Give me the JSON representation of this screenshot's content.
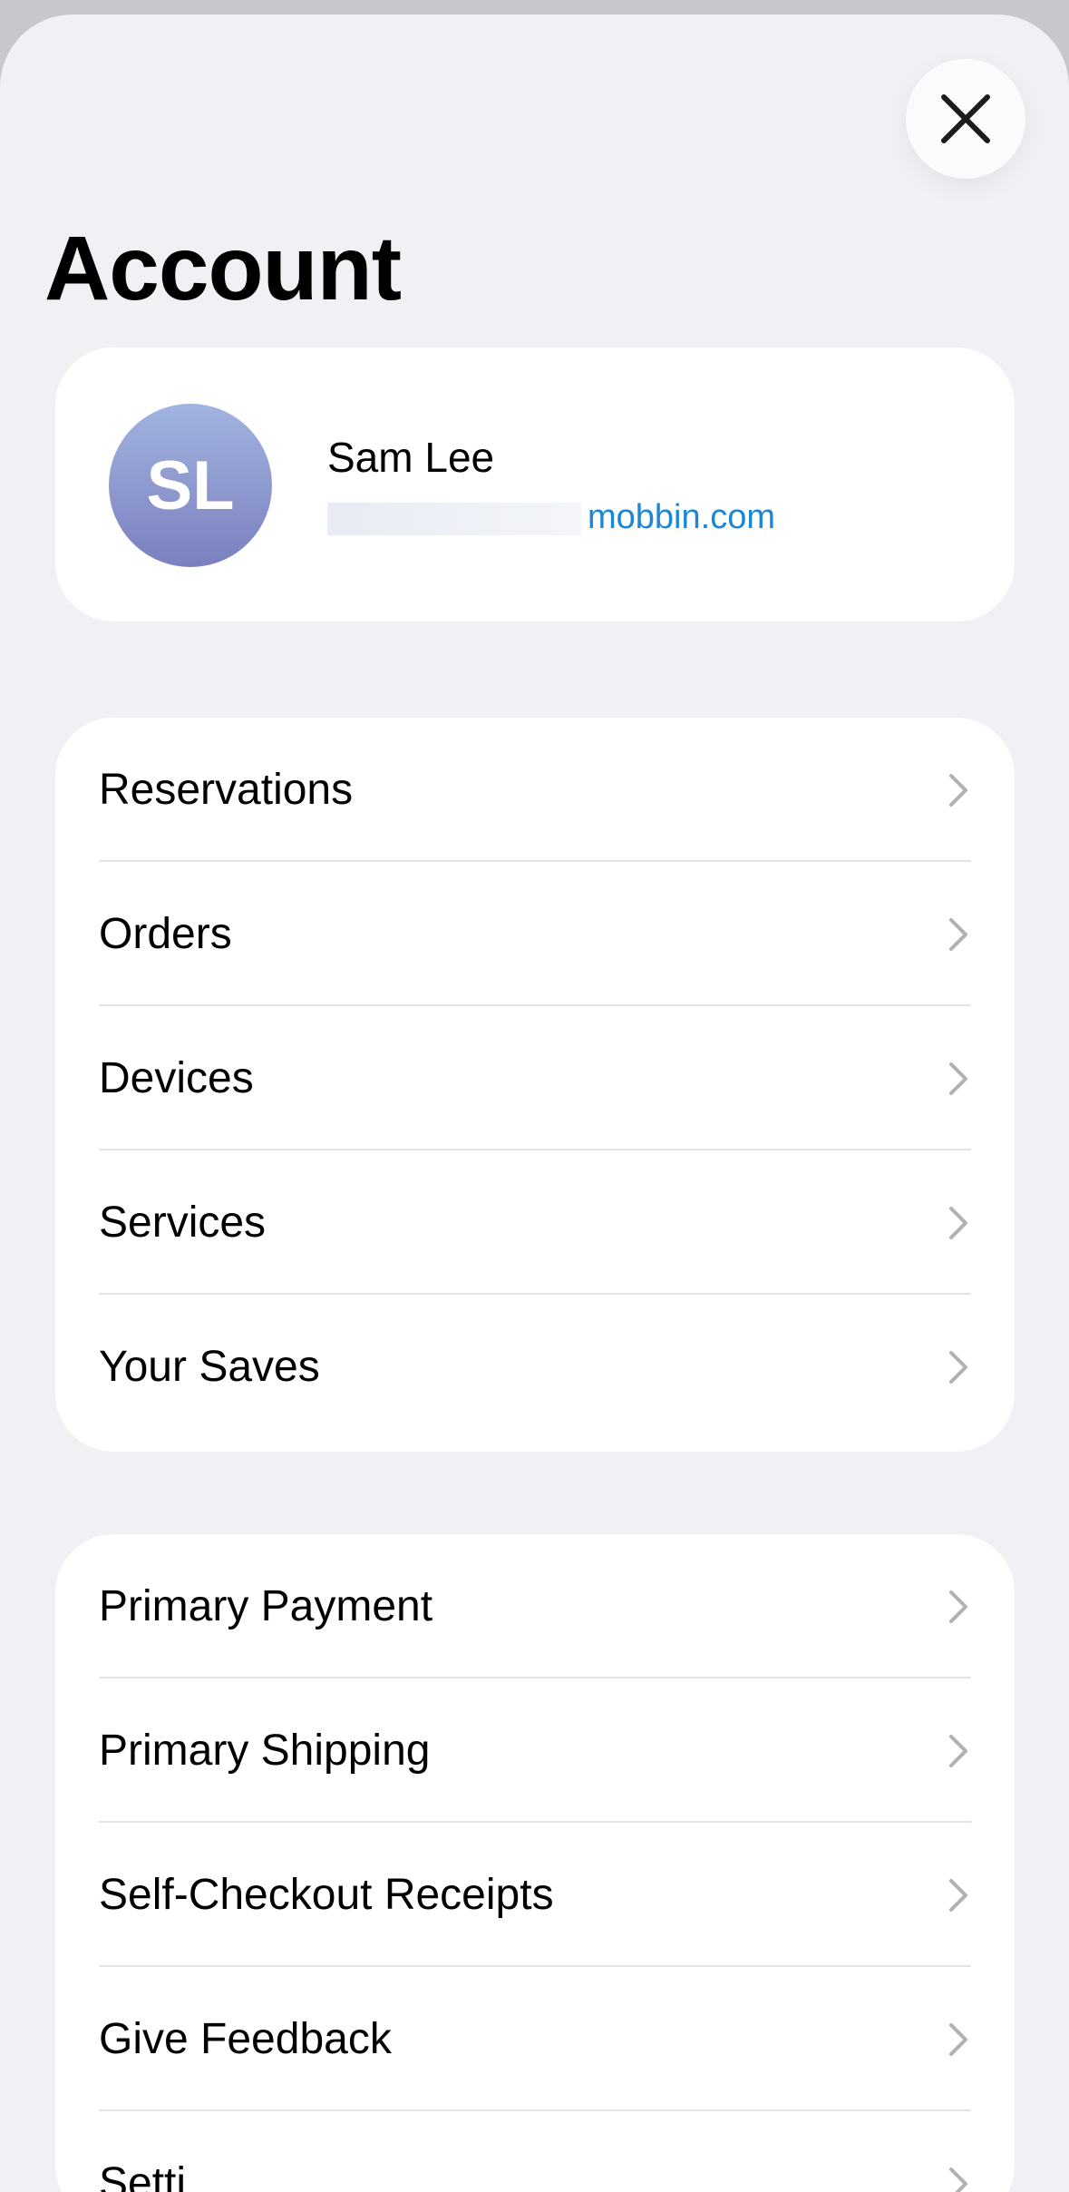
{
  "header": {
    "title": "Account",
    "close_icon": "close-icon"
  },
  "profile": {
    "initials": "SL",
    "name": "Sam Lee",
    "email": "mobbin.com"
  },
  "groups": [
    {
      "items": [
        {
          "label": "Reservations"
        },
        {
          "label": "Orders"
        },
        {
          "label": "Devices"
        },
        {
          "label": "Services"
        },
        {
          "label": "Your Saves"
        }
      ]
    },
    {
      "items": [
        {
          "label": "Primary Payment"
        },
        {
          "label": "Primary Shipping"
        },
        {
          "label": "Self-Checkout Receipts"
        },
        {
          "label": "Give Feedback"
        },
        {
          "label": "Setti"
        }
      ]
    }
  ],
  "colors": {
    "background": "#f0f0f5",
    "link": "#1b87d6",
    "chevron": "#b0b0b5"
  }
}
